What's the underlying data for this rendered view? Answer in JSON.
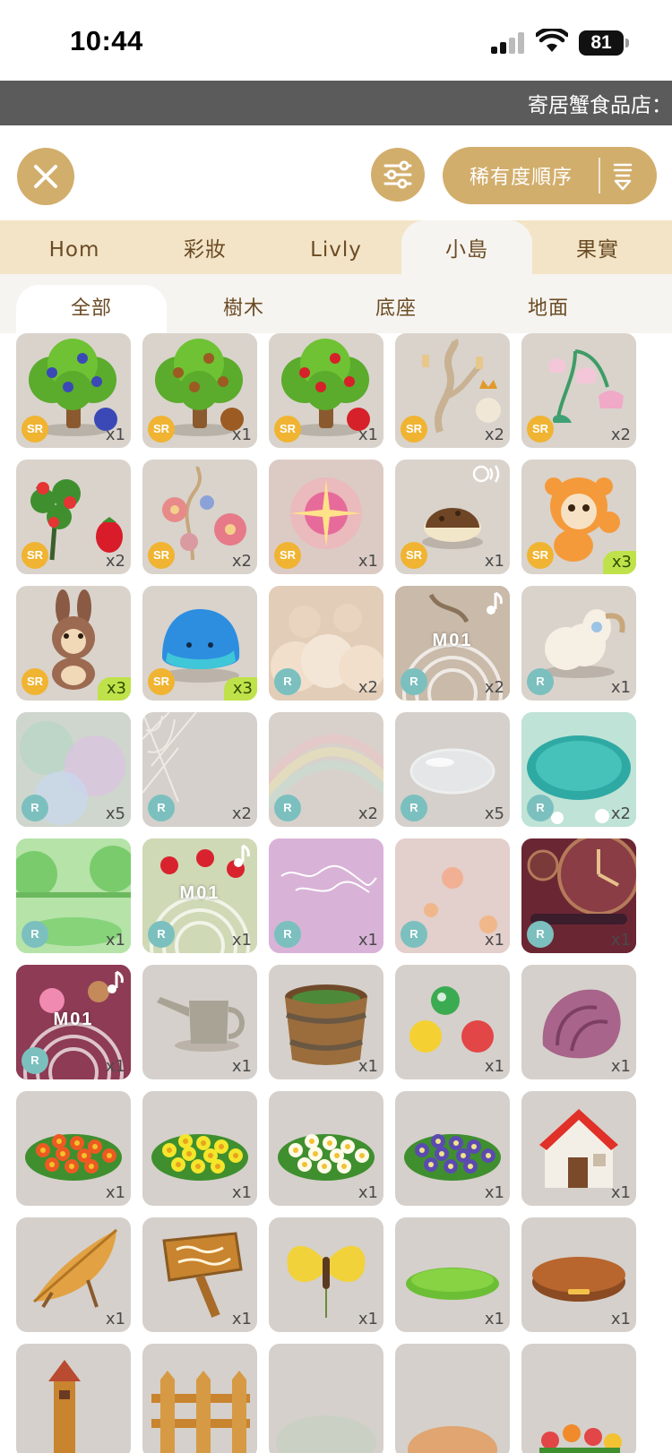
{
  "status_bar": {
    "time": "10:44",
    "battery": "81"
  },
  "banner": {
    "text": "寄居蟹食品店："
  },
  "toolbar": {
    "sort_label": "稀有度順序"
  },
  "tabs": [
    {
      "label": "Hom",
      "active": false
    },
    {
      "label": "彩妝",
      "active": false
    },
    {
      "label": "Livly",
      "active": false
    },
    {
      "label": "小島",
      "active": true
    },
    {
      "label": "果實",
      "active": false
    }
  ],
  "subtabs": [
    {
      "label": "全部",
      "active": true
    },
    {
      "label": "樹木",
      "active": false
    },
    {
      "label": "底座",
      "active": false
    },
    {
      "label": "地面",
      "active": false
    }
  ],
  "items": [
    {
      "name": "blueberry-tree",
      "rarity": "SR",
      "count": "x1",
      "bg": "#d9d3cc",
      "art": "tree-blue"
    },
    {
      "name": "chestnut-tree",
      "rarity": "SR",
      "count": "x1",
      "bg": "#d9d3cc",
      "art": "tree-brown"
    },
    {
      "name": "apple-tree",
      "rarity": "SR",
      "count": "x1",
      "bg": "#d9d3cc",
      "art": "tree-red"
    },
    {
      "name": "candle-branch",
      "rarity": "SR",
      "count": "x2",
      "bg": "#d9d3cc",
      "art": "candle"
    },
    {
      "name": "bellflower",
      "rarity": "SR",
      "count": "x2",
      "bg": "#d9d3cc",
      "art": "bell"
    },
    {
      "name": "strawberry-tree",
      "rarity": "SR",
      "count": "x2",
      "bg": "#d9d3cc",
      "art": "straw"
    },
    {
      "name": "flower-vine",
      "rarity": "SR",
      "count": "x2",
      "bg": "#d9d3cc",
      "art": "vine"
    },
    {
      "name": "pink-burst",
      "rarity": "SR",
      "count": "x1",
      "bg": "#d9cbc8",
      "art": "burst"
    },
    {
      "name": "turtle-pet",
      "rarity": "SR",
      "count": "x1",
      "bg": "#d9d3cc",
      "art": "turtle",
      "badge": "sound"
    },
    {
      "name": "orange-plush",
      "rarity": "SR",
      "count": "x3",
      "hl": true,
      "bg": "#d9d3cc",
      "art": "plush"
    },
    {
      "name": "bunny-plush",
      "rarity": "SR",
      "count": "x3",
      "hl": true,
      "bg": "#d9d3cc",
      "art": "bunny"
    },
    {
      "name": "blue-blob",
      "rarity": "SR",
      "count": "x3",
      "hl": true,
      "bg": "#d9d3cc",
      "art": "blob"
    },
    {
      "name": "sunset-clouds",
      "rarity": "R",
      "count": "x2",
      "bg": "#dcc8b6",
      "art": "clouds"
    },
    {
      "name": "m01-music-candle",
      "rarity": "R",
      "count": "x2",
      "bg": "#cbbdaf",
      "art": "m01a",
      "badge": "note",
      "tag": "M01"
    },
    {
      "name": "sheep",
      "rarity": "R",
      "count": "x1",
      "bg": "#d9d3cc",
      "art": "sheep"
    },
    {
      "name": "mist",
      "rarity": "R",
      "count": "x5",
      "bg": "#c9d1c9",
      "art": "mist"
    },
    {
      "name": "spider-web",
      "rarity": "R",
      "count": "x2",
      "bg": "#d5d0cb",
      "art": "web"
    },
    {
      "name": "rainbow",
      "rarity": "R",
      "count": "x2",
      "bg": "#d8d1cb",
      "art": "rainbow"
    },
    {
      "name": "bubble",
      "rarity": "R",
      "count": "x5",
      "bg": "#d5d0cb",
      "art": "bubble"
    },
    {
      "name": "pond",
      "rarity": "R",
      "count": "x2",
      "bg": "#b8ddd2",
      "art": "pond"
    },
    {
      "name": "green-forest",
      "rarity": "R",
      "count": "x1",
      "bg": "#a8d9a0",
      "art": "forest"
    },
    {
      "name": "m01-strawberry-arch",
      "rarity": "R",
      "count": "x1",
      "bg": "#c9d8b0",
      "art": "m01b",
      "badge": "note",
      "tag": "M01"
    },
    {
      "name": "purple-script",
      "rarity": "R",
      "count": "x1",
      "bg": "#d9b7d8",
      "art": "script"
    },
    {
      "name": "pink-glow",
      "rarity": "R",
      "count": "x1",
      "bg": "#e2c9c6",
      "art": "glow"
    },
    {
      "name": "clock-wall",
      "rarity": "R",
      "count": "x1",
      "bg": "#6d2a32",
      "art": "clock"
    },
    {
      "name": "m01-flower-frame",
      "rarity": "R",
      "count": "x1",
      "bg": "#8a3950",
      "art": "m01c",
      "badge": "note",
      "tag": "M01"
    },
    {
      "name": "watering-can",
      "rarity": "",
      "count": "x1",
      "bg": "#d5d0cb",
      "art": "can"
    },
    {
      "name": "wooden-tub",
      "rarity": "",
      "count": "x1",
      "bg": "#d5d0cb",
      "art": "tub"
    },
    {
      "name": "marbles",
      "rarity": "",
      "count": "x1",
      "bg": "#d5d0cb",
      "art": "marbles"
    },
    {
      "name": "shell",
      "rarity": "",
      "count": "x1",
      "bg": "#d5d0cb",
      "art": "shell"
    },
    {
      "name": "orange-flowers",
      "rarity": "",
      "count": "x1",
      "bg": "#d5d0cb",
      "art": "fl-orange"
    },
    {
      "name": "yellow-flowers",
      "rarity": "",
      "count": "x1",
      "bg": "#d5d0cb",
      "art": "fl-yellow"
    },
    {
      "name": "white-flowers",
      "rarity": "",
      "count": "x1",
      "bg": "#d5d0cb",
      "art": "fl-white"
    },
    {
      "name": "purple-flowers",
      "rarity": "",
      "count": "x1",
      "bg": "#d5d0cb",
      "art": "fl-purple"
    },
    {
      "name": "red-roof-house",
      "rarity": "",
      "count": "x1",
      "bg": "#d5d0cb",
      "art": "house"
    },
    {
      "name": "leaf-hammock",
      "rarity": "",
      "count": "x1",
      "bg": "#d5d0cb",
      "art": "leaf"
    },
    {
      "name": "wooden-sign",
      "rarity": "",
      "count": "x1",
      "bg": "#d5d0cb",
      "art": "sign"
    },
    {
      "name": "butterfly",
      "rarity": "",
      "count": "x1",
      "bg": "#d5d0cb",
      "art": "butterfly"
    },
    {
      "name": "grass-patch",
      "rarity": "",
      "count": "x1",
      "bg": "#d5d0cb",
      "art": "grass"
    },
    {
      "name": "wood-disc",
      "rarity": "",
      "count": "x1",
      "bg": "#d5d0cb",
      "art": "disc"
    },
    {
      "name": "lighthouse",
      "rarity": "",
      "count": "",
      "bg": "#d5d0cb",
      "art": "tower"
    },
    {
      "name": "fence",
      "rarity": "",
      "count": "",
      "bg": "#d5d0cb",
      "art": "fence"
    },
    {
      "name": "pale-mound",
      "rarity": "",
      "count": "",
      "bg": "#d5d0cb",
      "art": "mound"
    },
    {
      "name": "sand-mound",
      "rarity": "",
      "count": "",
      "bg": "#d5d0cb",
      "art": "sand"
    },
    {
      "name": "tulip-bed",
      "rarity": "",
      "count": "",
      "bg": "#d5d0cb",
      "art": "tulip"
    }
  ]
}
